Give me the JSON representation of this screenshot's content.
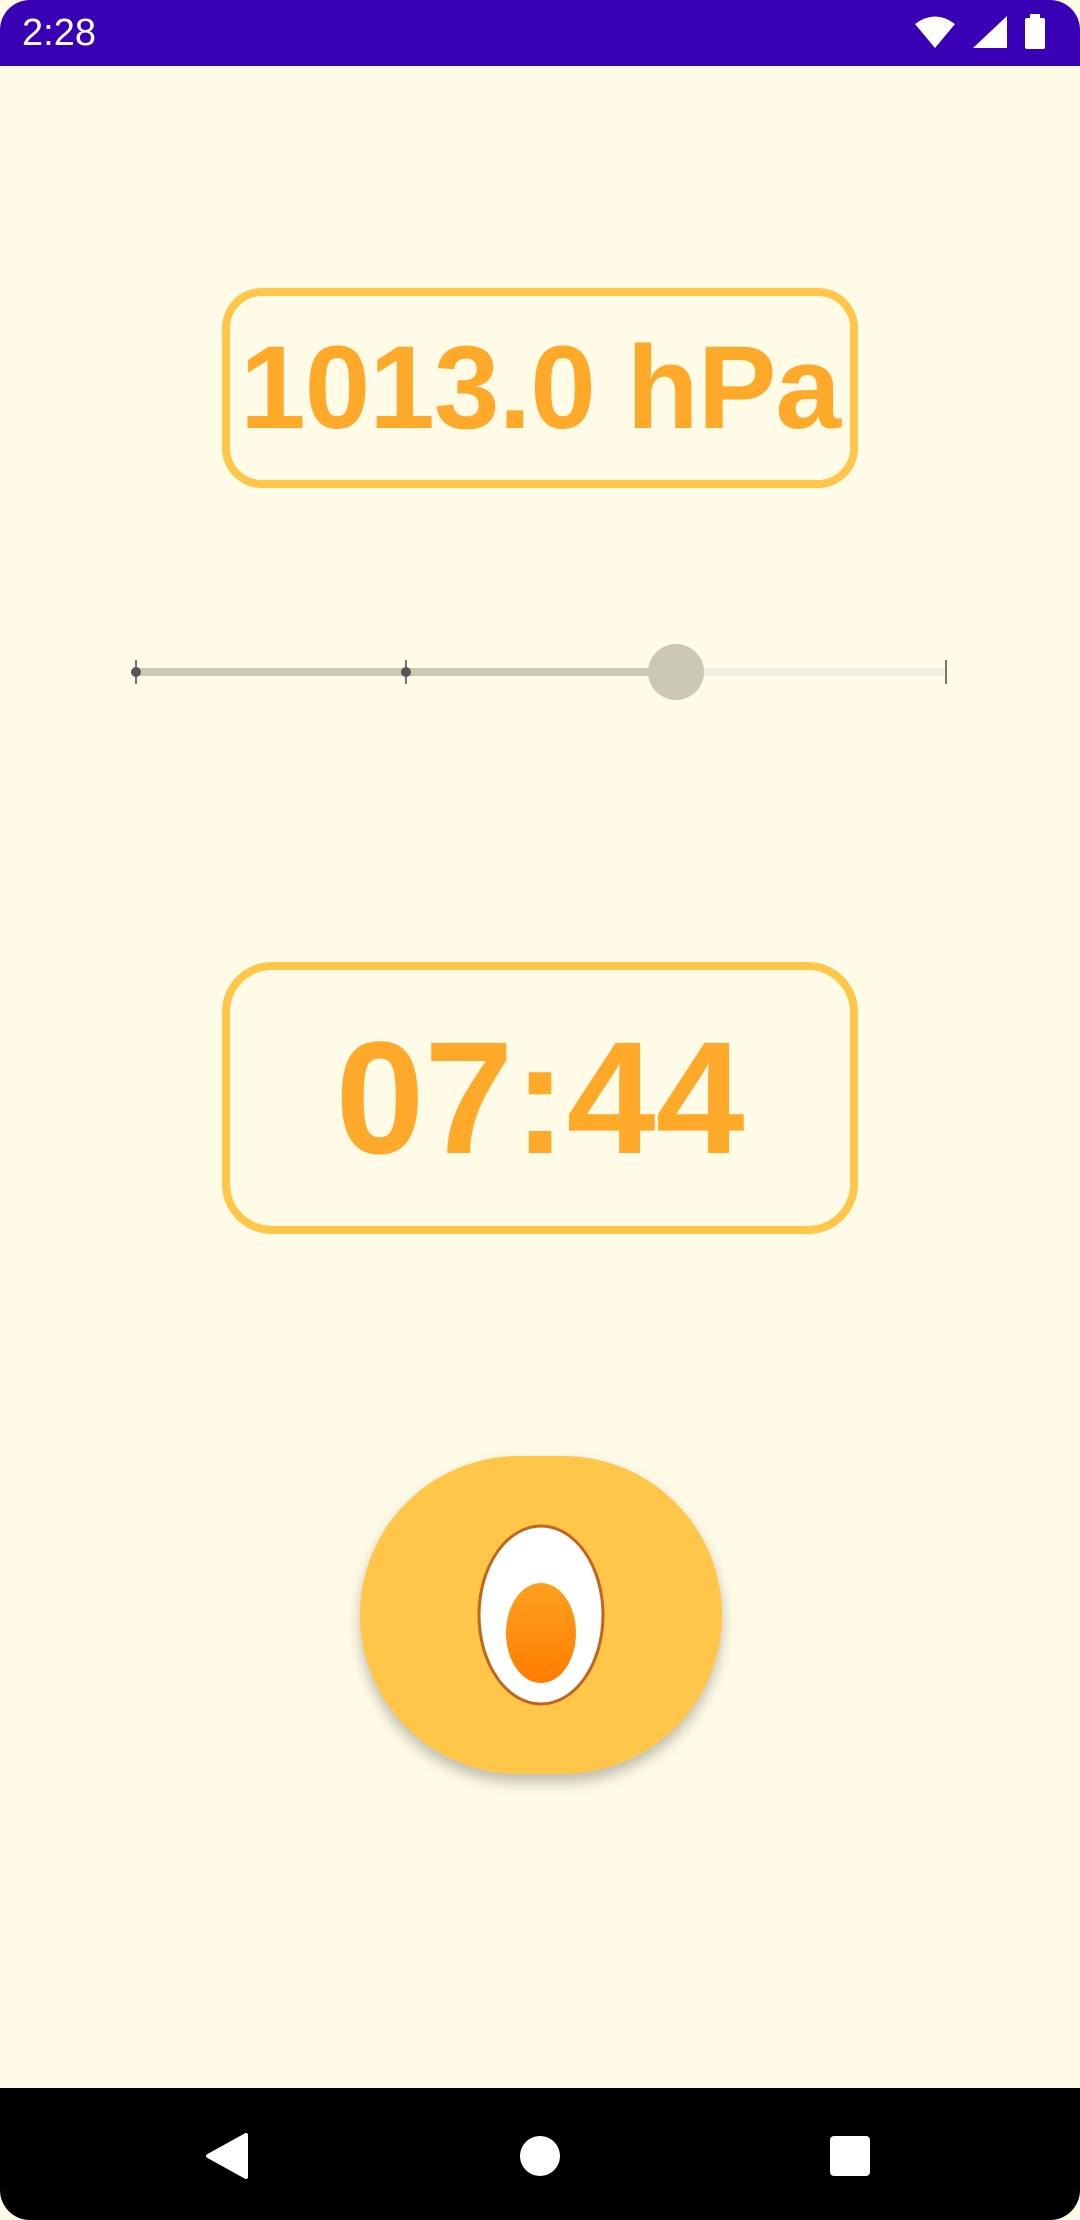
{
  "status_bar": {
    "time": "2:28",
    "icons": [
      "wifi-icon",
      "cell-signal-icon",
      "battery-icon"
    ]
  },
  "pressure": {
    "display": "1013.0 hPa"
  },
  "slider": {
    "level_fraction": 0.667,
    "tick_fractions": [
      0,
      0.333,
      0.667,
      1
    ]
  },
  "timer": {
    "display": "07:44"
  },
  "egg_button": {
    "icon": "egg-icon"
  },
  "nav_bar": {
    "icons": [
      "back-icon",
      "home-icon",
      "recents-icon"
    ]
  },
  "colors": {
    "background": "#fffbe6",
    "status_bar": "#3a00b6",
    "accent": "#ffc64a",
    "text_accent": "#ffa92a",
    "slider_fill": "#cbc9b4"
  }
}
